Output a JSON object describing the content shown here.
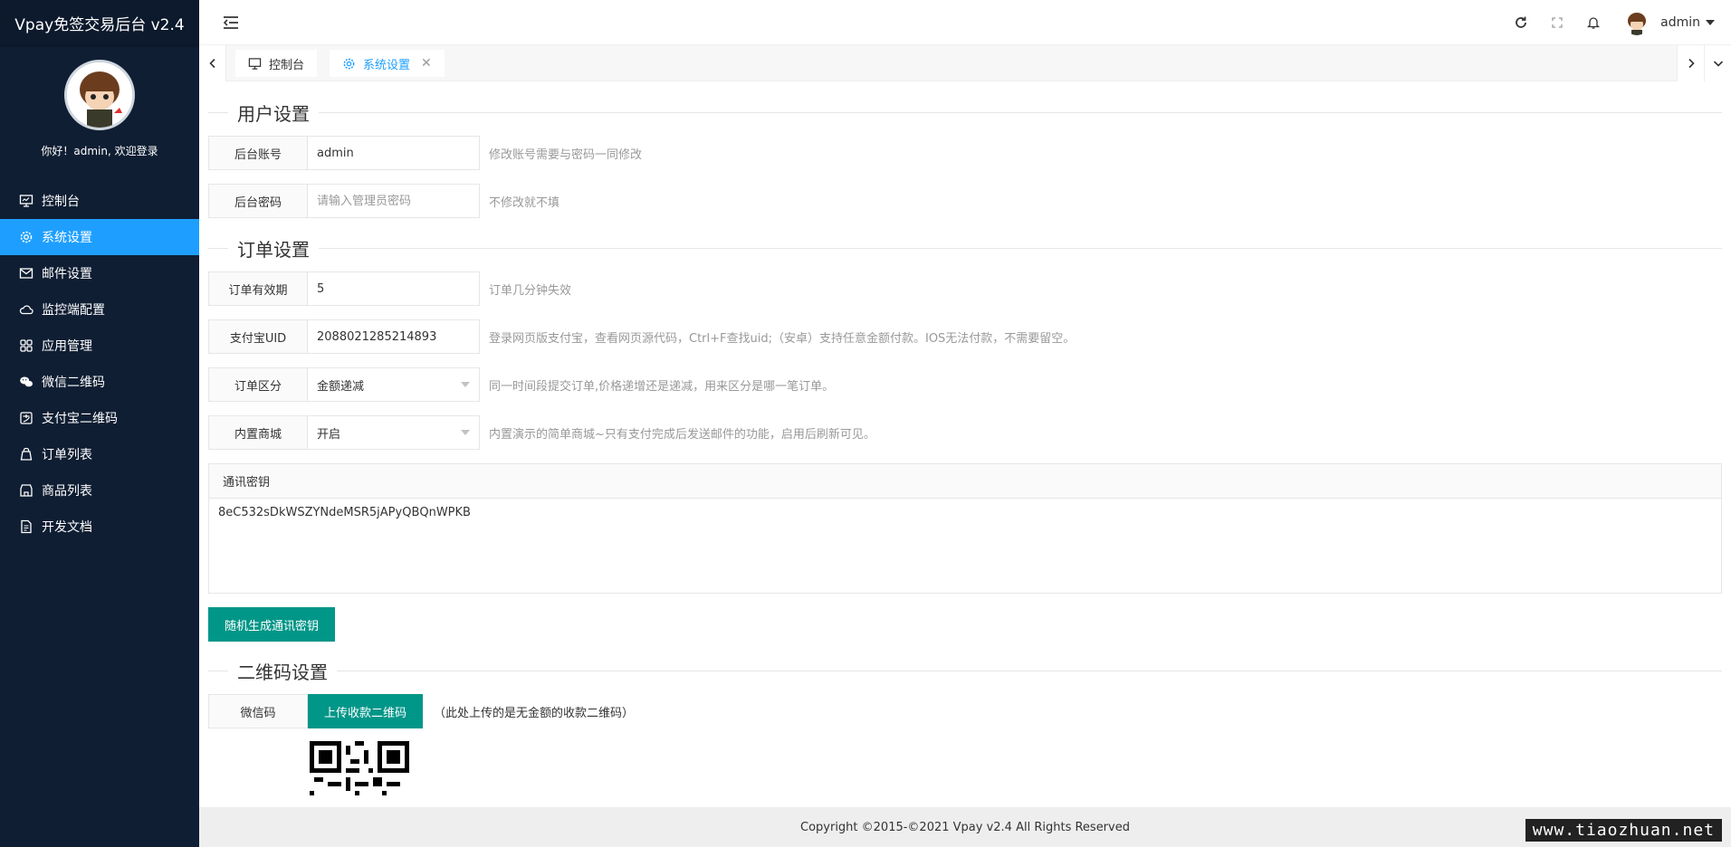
{
  "app": {
    "title": "Vpay免签交易后台 v2.4"
  },
  "user": {
    "welcome": "你好！admin, 欢迎登录",
    "name": "admin"
  },
  "sidebar": {
    "items": [
      {
        "label": "控制台",
        "icon": "monitor-icon"
      },
      {
        "label": "系统设置",
        "icon": "gear-icon",
        "active": true
      },
      {
        "label": "邮件设置",
        "icon": "mail-icon"
      },
      {
        "label": "监控端配置",
        "icon": "cloud-icon"
      },
      {
        "label": "应用管理",
        "icon": "grid-icon"
      },
      {
        "label": "微信二维码",
        "icon": "wechat-icon"
      },
      {
        "label": "支付宝二维码",
        "icon": "alipay-icon"
      },
      {
        "label": "订单列表",
        "icon": "bag-icon"
      },
      {
        "label": "商品列表",
        "icon": "shop-icon"
      },
      {
        "label": "开发文档",
        "icon": "doc-icon"
      }
    ]
  },
  "tabs": [
    {
      "label": "控制台",
      "icon": "monitor-icon"
    },
    {
      "label": "系统设置",
      "icon": "gear-icon",
      "active": true,
      "close": "✕"
    }
  ],
  "form": {
    "user_section": "用户设置",
    "account": {
      "label": "后台账号",
      "value": "admin",
      "help": "修改账号需要与密码一同修改"
    },
    "password": {
      "label": "后台密码",
      "placeholder": "请输入管理员密码",
      "help": "不修改就不填"
    },
    "order_section": "订单设置",
    "expire": {
      "label": "订单有效期",
      "value": "5",
      "help": "订单几分钟失效"
    },
    "alipay_uid": {
      "label": "支付宝UID",
      "value": "2088021285214893",
      "help": "登录网页版支付宝，查看网页源代码，Ctrl+F查找uid;（安卓）支持任意金额付款。IOS无法付款，不需要留空。"
    },
    "order_mode": {
      "label": "订单区分",
      "value": "金额递减",
      "help": "同一时间段提交订单,价格递增还是递减，用来区分是哪一笔订单。"
    },
    "shop": {
      "label": "内置商城",
      "value": "开启",
      "help": "内置演示的简单商城~只有支付完成后发送邮件的功能，启用后刷新可见。"
    },
    "key": {
      "label": "通讯密钥",
      "value": "8eC532sDkWSZYNdeMSR5jAPyQBQnWPKB"
    },
    "gen_button": "随机生成通讯密钥",
    "qr_section": "二维码设置",
    "wechat_qr": {
      "label": "微信码",
      "upload": "上传收款二维码",
      "note": "（此处上传的是无金额的收款二维码）"
    }
  },
  "footer": {
    "copyright": "Copyright ©2015-©2021 Vpay v2.4 All Rights Reserved"
  },
  "watermark": "www.tiaozhuan.net",
  "colors": {
    "sidebar": "#0f1e33",
    "active": "#1e9fff",
    "primary_button": "#009688"
  }
}
